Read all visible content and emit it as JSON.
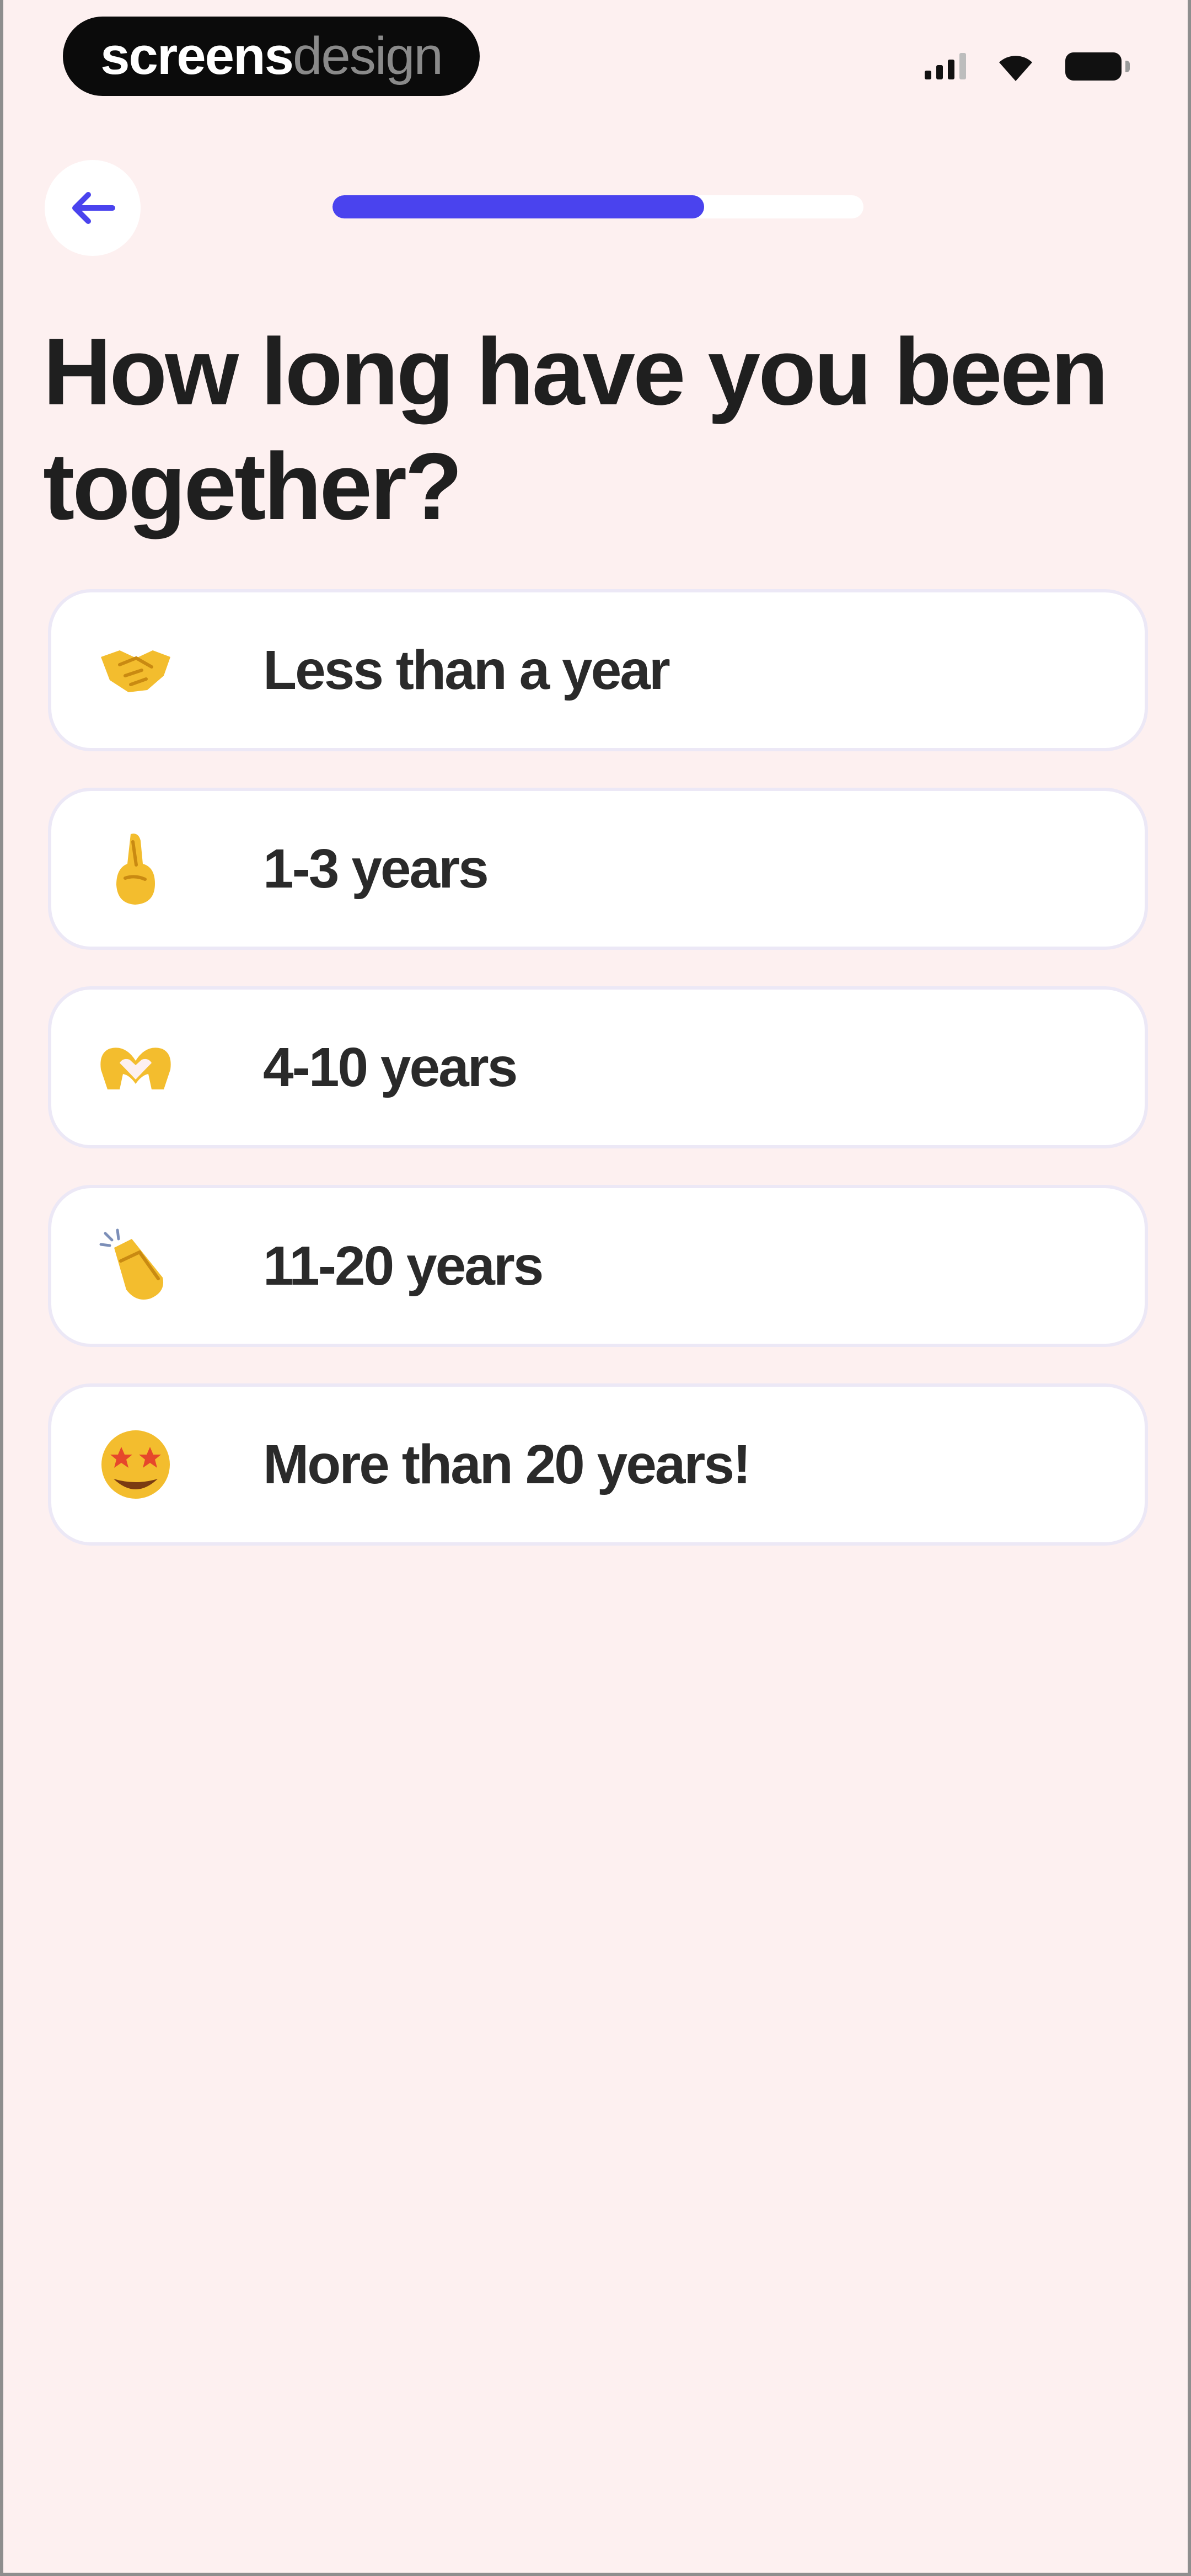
{
  "status_bar": {
    "brand_strong": "screens",
    "brand_light": "design"
  },
  "header": {
    "back_icon": "arrow-left-icon",
    "progress_fraction": 0.7
  },
  "question": "How long have you been together?",
  "options": [
    {
      "emoji": "handshake-icon",
      "label": "Less than a year"
    },
    {
      "emoji": "fingers-crossed-icon",
      "label": "1-3 years"
    },
    {
      "emoji": "heart-hands-icon",
      "label": "4-10 years"
    },
    {
      "emoji": "clapping-hands-icon",
      "label": "11-20 years"
    },
    {
      "emoji": "star-struck-face-icon",
      "label": "More than 20 years!"
    }
  ],
  "colors": {
    "background": "#fdf0f0",
    "accent": "#4a43ee",
    "emoji_yellow": "#f3bd2e"
  }
}
